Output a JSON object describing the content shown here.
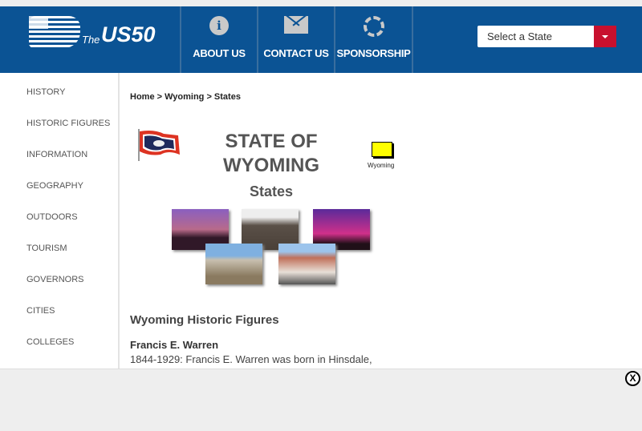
{
  "header": {
    "logo_the": "The",
    "logo_us50": "US50",
    "nav": [
      {
        "label": "ABOUT US",
        "icon": "info-icon"
      },
      {
        "label": "CONTACT US",
        "icon": "envelope-icon"
      },
      {
        "label": "SPONSORSHIP",
        "icon": "cycle-icon"
      }
    ],
    "state_select": "Select a State"
  },
  "sidebar": [
    "HISTORY",
    "HISTORIC FIGURES",
    "INFORMATION",
    "GEOGRAPHY",
    "OUTDOORS",
    "TOURISM",
    "GOVERNORS",
    "CITIES",
    "COLLEGES"
  ],
  "breadcrumb": "Home > Wyoming > States",
  "title_line1": "STATE OF",
  "title_line2": "WYOMING",
  "subtitle": "States",
  "map_caption": "Wyoming",
  "section_title": "Wyoming Historic Figures",
  "figure": {
    "name": "Francis E. Warren",
    "desc": "1844-1929: Francis E. Warren was born in Hinsdale,"
  },
  "ad_close": "X",
  "colors": {
    "brand": "#0b5394",
    "accent": "#c8102e"
  }
}
